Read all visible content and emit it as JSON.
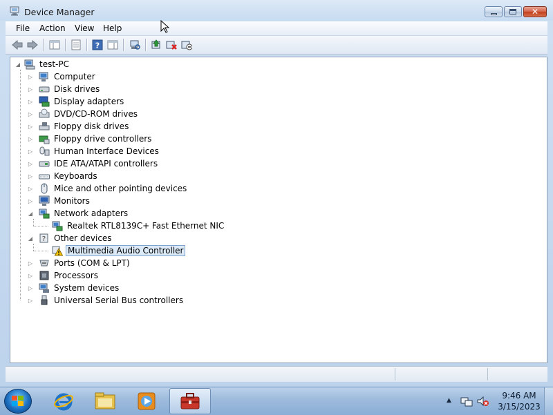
{
  "window": {
    "title": "Device Manager",
    "close_glyph": "✕"
  },
  "menu": {
    "file": "File",
    "action": "Action",
    "view": "View",
    "help": "Help"
  },
  "toolbar": {
    "icons": [
      "back-arrow-icon",
      "forward-arrow-icon",
      "show-hide-tree-icon",
      "properties-icon",
      "help-icon",
      "show-hide-action-pane-icon",
      "scan-hardware-icon",
      "update-driver-icon",
      "uninstall-icon",
      "disable-device-icon"
    ]
  },
  "tree": {
    "root": "test-PC",
    "categories": [
      {
        "label": "Computer",
        "icon": "computer-icon"
      },
      {
        "label": "Disk drives",
        "icon": "disk-drive-icon"
      },
      {
        "label": "Display adapters",
        "icon": "display-adapter-icon"
      },
      {
        "label": "DVD/CD-ROM drives",
        "icon": "dvd-drive-icon"
      },
      {
        "label": "Floppy disk drives",
        "icon": "floppy-drive-icon"
      },
      {
        "label": "Floppy drive controllers",
        "icon": "floppy-controller-icon"
      },
      {
        "label": "Human Interface Devices",
        "icon": "hid-icon"
      },
      {
        "label": "IDE ATA/ATAPI controllers",
        "icon": "ide-controller-icon"
      },
      {
        "label": "Keyboards",
        "icon": "keyboard-icon"
      },
      {
        "label": "Mice and other pointing devices",
        "icon": "mouse-icon"
      },
      {
        "label": "Monitors",
        "icon": "monitor-icon"
      },
      {
        "label": "Network adapters",
        "icon": "network-adapter-icon",
        "expanded": true
      },
      {
        "label": "Realtek RTL8139C+ Fast Ethernet NIC",
        "icon": "network-adapter-icon",
        "child": true
      },
      {
        "label": "Other devices",
        "icon": "other-devices-icon",
        "expanded": true
      },
      {
        "label": "Multimedia Audio Controller",
        "icon": "warning-device-icon",
        "child": true,
        "selected": true
      },
      {
        "label": "Ports (COM & LPT)",
        "icon": "port-icon"
      },
      {
        "label": "Processors",
        "icon": "processor-icon"
      },
      {
        "label": "System devices",
        "icon": "system-device-icon"
      },
      {
        "label": "Universal Serial Bus controllers",
        "icon": "usb-icon"
      }
    ]
  },
  "taskbar": {
    "pinned": [
      "internet-explorer-icon",
      "windows-explorer-icon",
      "media-player-icon",
      "device-manager-icon"
    ],
    "tray_up": "▲",
    "time": "9:46 AM",
    "date": "3/15/2023"
  },
  "colors": {
    "selection_bg": "#dceaf8",
    "selection_border": "#7da2ce",
    "titlebar": "#c7dbf1",
    "taskbar": "#9fbcdd"
  }
}
